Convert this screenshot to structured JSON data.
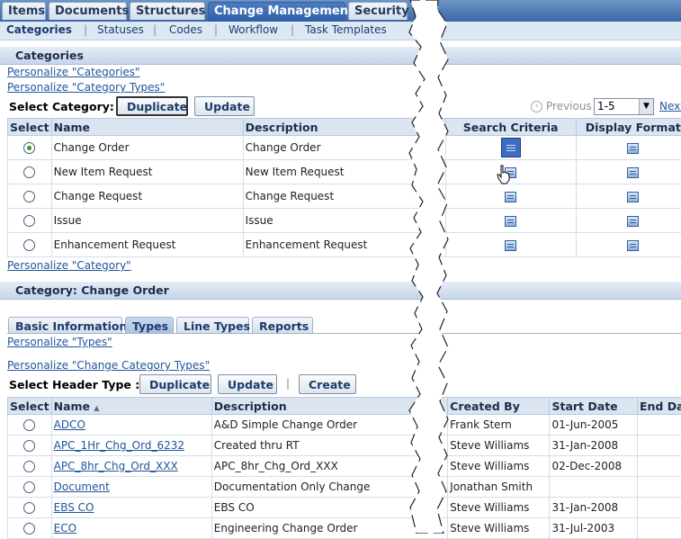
{
  "top_tabs": [
    "Items",
    "Documents",
    "Structures",
    "Change Management",
    "Security"
  ],
  "sub_tabs": [
    "Categories",
    "Statuses",
    "Codes",
    "Workflow",
    "Task Templates"
  ],
  "categories_section": {
    "title": "Categories",
    "links": [
      "Personalize \"Categories\"",
      "Personalize \"Category Types\""
    ],
    "select_label": "Select Category:",
    "duplicate": "Duplicate",
    "update": "Update",
    "previous": "Previous",
    "range": "1-5",
    "next": "Next",
    "headers": [
      "Select",
      "Name",
      "Description",
      "Search Criteria",
      "Display Format"
    ],
    "rows": [
      {
        "name": "Change Order",
        "description": "Change Order",
        "selected": true
      },
      {
        "name": "New Item Request",
        "description": "New Item Request",
        "selected": false
      },
      {
        "name": "Change Request",
        "description": "Change Request",
        "selected": false
      },
      {
        "name": "Issue",
        "description": "Issue",
        "selected": false
      },
      {
        "name": "Enhancement Request",
        "description": "Enhancement Request",
        "selected": false
      }
    ],
    "footer_link": "Personalize \"Category\""
  },
  "detail_section": {
    "title": "Category: Change Order",
    "tabs": [
      "Basic Information",
      "Types",
      "Line Types",
      "Reports"
    ],
    "links": [
      "Personalize \"Types\"",
      "Personalize \"Change Category Types\""
    ],
    "select_label": "Select Header Type :",
    "duplicate": "Duplicate",
    "update": "Update",
    "create": "Create",
    "separator": "|",
    "headers": [
      "Select",
      "Name",
      "Description",
      "Created By",
      "Start Date",
      "End Date"
    ],
    "rows": [
      {
        "name": "ADCO",
        "description": "A&D Simple Change Order",
        "created_by": "Frank Stern",
        "start_date": "01-Jun-2005"
      },
      {
        "name": "APC_1Hr_Chg_Ord_6232",
        "description": "Created thru RT",
        "created_by": "Steve Williams",
        "start_date": "31-Jan-2008"
      },
      {
        "name": "APC_8hr_Chg_Ord_XXX",
        "description": "APC_8hr_Chg_Ord_XXX",
        "created_by": "Steve Williams",
        "start_date": "02-Dec-2008"
      },
      {
        "name": "Document",
        "description": "Documentation Only Change",
        "created_by": "Jonathan Smith",
        "start_date": ""
      },
      {
        "name": "EBS CO",
        "description": "EBS CO",
        "created_by": "Steve Williams",
        "start_date": "31-Jan-2008"
      },
      {
        "name": "ECO",
        "description": "Engineering Change Order",
        "created_by": "Steve Williams",
        "start_date": "31-Jul-2003"
      }
    ]
  }
}
